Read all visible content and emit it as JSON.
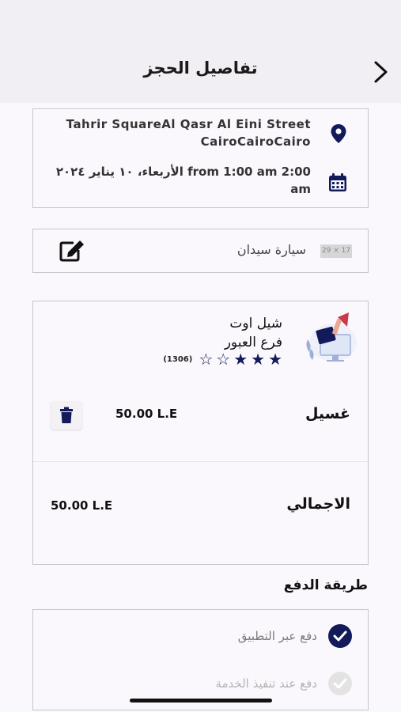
{
  "header": {
    "title": "تفاصيل الحجز",
    "back_icon": "chevron-right-icon"
  },
  "location": {
    "address": "Tahrir SquareAl Qasr Al Eini Street CairoCairoCairo",
    "datetime": "الأربعاء، ١٠ يناير ٢٠٢٤ from 1:00 am 2:00 am",
    "pin_icon": "map-pin-icon",
    "calendar_icon": "calendar-icon"
  },
  "car": {
    "name": "سيارة سيدان",
    "image_placeholder": "29 × 17",
    "edit_icon": "edit-icon"
  },
  "order": {
    "shop_name": "شيل اوت",
    "branch_name": "فرع العبور",
    "rating": 3,
    "rating_max": 5,
    "reviews_count": "(1306)",
    "service_name": "غسيل",
    "service_price": "50.00 L.E",
    "total_label": "الاجمالي",
    "total_price": "50.00 L.E"
  },
  "payment": {
    "title": "طريقة الدفع",
    "options": [
      {
        "label": "دفع عبر التطبيق",
        "selected": true
      },
      {
        "label": "دفع عند تنفيذ الخدمة",
        "selected": false
      }
    ]
  },
  "colors": {
    "primary": "#131a5a",
    "header_bg": "#f1eff3",
    "page_bg": "#fbf8fd",
    "border": "#c9c6cb"
  }
}
